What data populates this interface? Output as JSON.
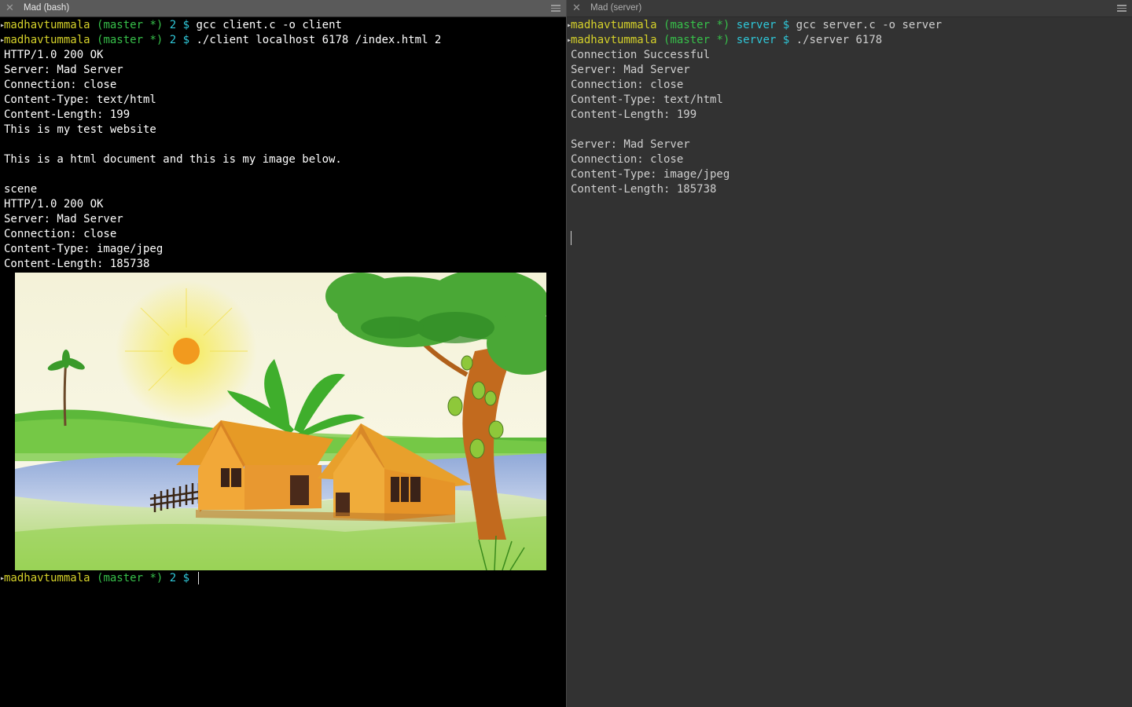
{
  "left_pane": {
    "tab_title": "Mad (bash)",
    "prompt": {
      "user": "madhavtummala",
      "branch": "(master *)",
      "dir": "2",
      "symbol": "$"
    },
    "commands": [
      "gcc client.c -o client",
      "./client localhost 6178 /index.html 2"
    ],
    "output": [
      "HTTP/1.0 200 OK",
      "Server: Mad Server",
      "Connection: close",
      "Content-Type: text/html",
      "Content-Length: 199",
      "This is my test website",
      "",
      "This is a html document and this is my image below.",
      "",
      "scene",
      "HTTP/1.0 200 OK",
      "Server: Mad Server",
      "Connection: close",
      "Content-Type: image/jpeg",
      "Content-Length: 185738"
    ],
    "image_name": "scene-drawing"
  },
  "right_pane": {
    "tab_title": "Mad (server)",
    "prompt": {
      "user": "madhavtummala",
      "branch": "(master *)",
      "dir": "server",
      "symbol": "$"
    },
    "commands": [
      "gcc server.c -o server",
      "./server 6178"
    ],
    "output": [
      "Connection Successful",
      "Server: Mad Server",
      "Connection: close",
      "Content-Type: text/html",
      "Content-Length: 199",
      "",
      "Server: Mad Server",
      "Connection: close",
      "Content-Type: image/jpeg",
      "Content-Length: 185738"
    ]
  },
  "icons": {
    "close": "close-icon",
    "menu": "hamburger-menu-icon"
  },
  "colors": {
    "user": "#d6d22a",
    "branch": "#37c04a",
    "dir": "#2fc7d8",
    "left_bg": "#000000",
    "right_bg": "#323232"
  }
}
